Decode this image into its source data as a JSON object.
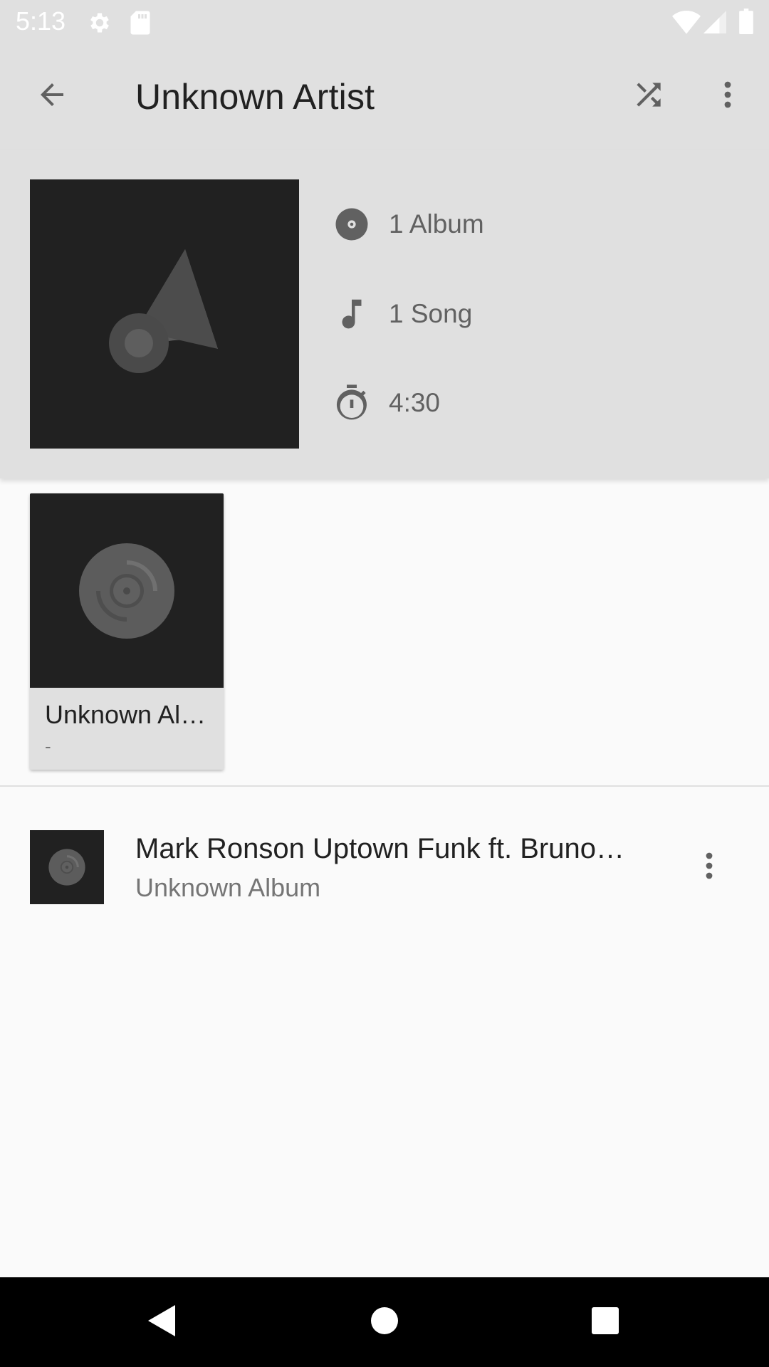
{
  "status_bar": {
    "time": "5:13",
    "icons": [
      "gear-icon",
      "sd-card-icon",
      "wifi-icon",
      "signal-icon",
      "battery-icon"
    ]
  },
  "toolbar": {
    "title": "Unknown Artist",
    "back_icon": "arrow-back-icon",
    "shuffle_icon": "shuffle-icon",
    "more_icon": "more-vert-icon"
  },
  "header": {
    "stats": {
      "albums": "1 Album",
      "songs": "1 Song",
      "duration": "4:30"
    }
  },
  "albums": [
    {
      "title": "Unknown Al…",
      "subtitle": "-"
    }
  ],
  "songs": [
    {
      "title": "Mark Ronson  Uptown Funk ft. Bruno…",
      "subtitle": "Unknown Album"
    }
  ],
  "colors": {
    "header_bg": "#e0e0e0",
    "art_bg": "#212121",
    "icon": "#616161",
    "page_bg": "#fafafa"
  }
}
